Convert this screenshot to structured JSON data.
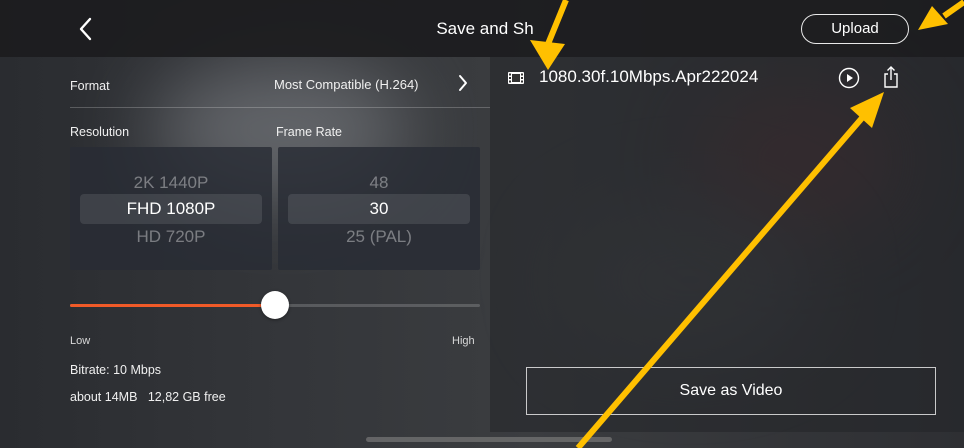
{
  "header": {
    "title": "Save and Sh",
    "back_glyph": "<",
    "upload_label": "Upload"
  },
  "settings": {
    "format_label": "Format",
    "format_value": "Most Compatible (H.264)",
    "resolution_label": "Resolution",
    "frame_rate_label": "Frame Rate",
    "resolution_options": [
      "2K 1440P",
      "FHD 1080P",
      "HD 720P"
    ],
    "resolution_selected": "FHD 1080P",
    "frame_rate_options": [
      "48",
      "30",
      "25 (PAL)"
    ],
    "frame_rate_selected": "30",
    "bitrate_slider_fraction": 0.5,
    "slider_low_label": "Low",
    "slider_high_label": "High",
    "bitrate_text": "Bitrate: 10 Mbps",
    "size_text": "about 14MB   12,82 GB free"
  },
  "export": {
    "filename": "1080.30f.10Mbps.Apr222024",
    "save_video_label": "Save as Video"
  },
  "colors": {
    "accent_slider": "#f05a28",
    "annotation_arrow": "#ffc000"
  },
  "icons": [
    "chevron-left-icon",
    "chevron-right-icon",
    "film-icon",
    "play-icon",
    "share-icon"
  ]
}
